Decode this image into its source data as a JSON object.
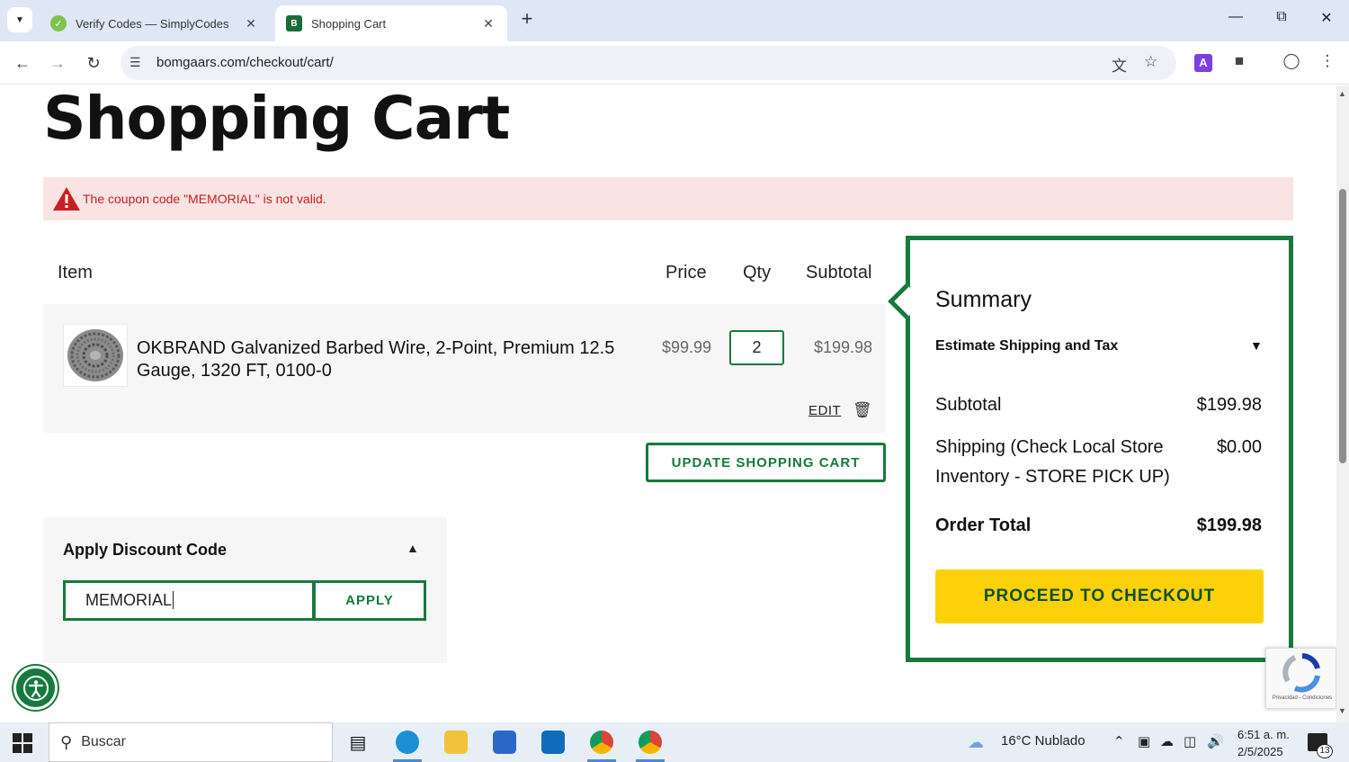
{
  "browser": {
    "tabs": [
      {
        "label": "Verify Codes — SimplyCodes",
        "active": false
      },
      {
        "label": "Shopping Cart",
        "active": true
      }
    ],
    "url": "bomgaars.com/checkout/cart/"
  },
  "page": {
    "title": "Shopping Cart",
    "alert": "The coupon code \"MEMORIAL\" is not valid.",
    "cart_headers": {
      "item": "Item",
      "price": "Price",
      "qty": "Qty",
      "subtotal": "Subtotal"
    },
    "items": [
      {
        "name": "OKBRAND Galvanized Barbed Wire, 2-Point, Premium 12.5 Gauge, 1320 FT, 0100-0",
        "price": "$99.99",
        "qty": "2",
        "subtotal": "$199.98",
        "edit_label": "EDIT"
      }
    ],
    "update_cart_label": "UPDATE SHOPPING CART",
    "discount": {
      "title": "Apply Discount Code",
      "code_value": "MEMORIAL",
      "apply_label": "APPLY"
    },
    "summary": {
      "title": "Summary",
      "estimate_label": "Estimate Shipping and Tax",
      "subtotal_label": "Subtotal",
      "subtotal_value": "$199.98",
      "shipping_label": "Shipping (Check Local Store Inventory - STORE PICK UP)",
      "shipping_value": "$0.00",
      "order_total_label": "Order Total",
      "order_total_value": "$199.98",
      "checkout_label": "PROCEED TO CHECKOUT"
    },
    "recaptcha_text": "Privacidad - Condiciones"
  },
  "taskbar": {
    "search_placeholder": "Buscar",
    "weather": "16°C  Nublado",
    "time": "6:51 a. m.",
    "date": "2/5/2025",
    "notifications": "13"
  },
  "colors": {
    "brand_green": "#157a3c",
    "checkout_yellow": "#fdd10a",
    "alert_bg": "#fae3e3",
    "alert_text": "#c62020"
  }
}
